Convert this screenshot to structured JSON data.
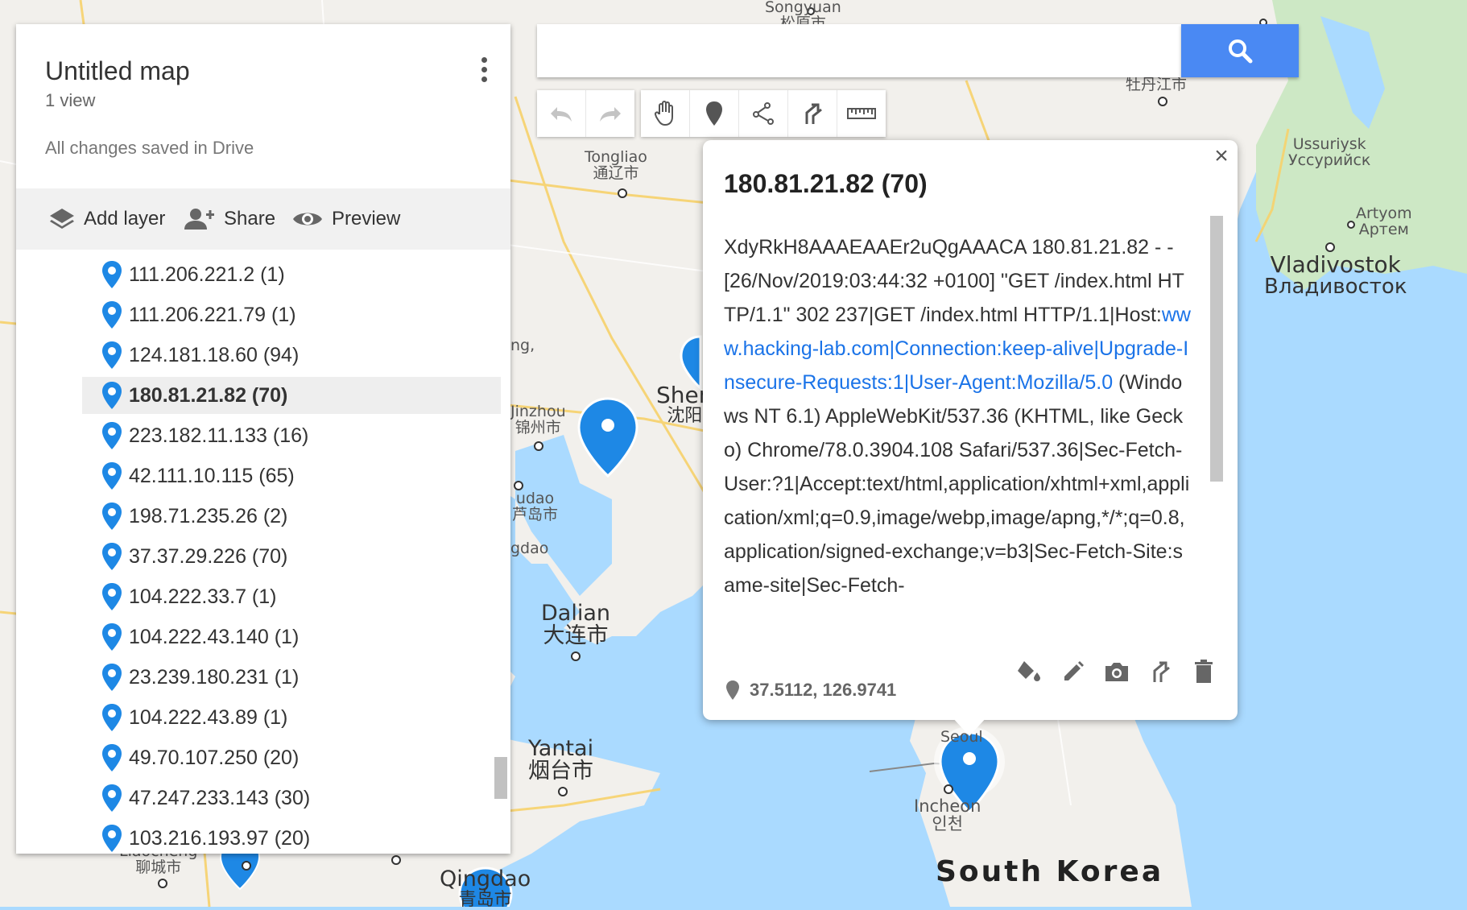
{
  "panel": {
    "title": "Untitled map",
    "views": "1 view",
    "save_status": "All changes saved in Drive",
    "toolbar": {
      "add_layer": "Add layer",
      "share": "Share",
      "preview": "Preview"
    },
    "items": [
      {
        "label": "111.206.221.2 (1)"
      },
      {
        "label": "111.206.221.79 (1)"
      },
      {
        "label": "124.181.18.60 (94)"
      },
      {
        "label": "180.81.21.82 (70)",
        "selected": true
      },
      {
        "label": "223.182.11.133 (16)"
      },
      {
        "label": "42.111.10.115 (65)"
      },
      {
        "label": "198.71.235.26 (2)"
      },
      {
        "label": "37.37.29.226 (70)"
      },
      {
        "label": "104.222.33.7 (1)"
      },
      {
        "label": "104.222.43.140 (1)"
      },
      {
        "label": "23.239.180.231 (1)"
      },
      {
        "label": "104.222.43.89 (1)"
      },
      {
        "label": "49.70.107.250 (20)"
      },
      {
        "label": "47.247.233.143 (30)"
      },
      {
        "label": "103.216.193.97 (20)"
      }
    ]
  },
  "search": {
    "placeholder": ""
  },
  "toolbar_icons": [
    "undo-icon",
    "redo-icon",
    "hand-icon",
    "marker-icon",
    "draw-line-icon",
    "directions-icon",
    "ruler-icon"
  ],
  "info": {
    "title": "180.81.21.82 (70)",
    "body_plain_1": "XdyRkH8AAAEAAEr2uQgAAACA 180.81.21.82 - - [26/Nov/2019:03:44:32 +0100] \"GET /index.html HTTP/1.1\" 302 237|GET /index.html HTTP/1.1|Host:",
    "body_link": "www.hacking-lab.com|Connection:keep-alive|Upgrade-Insecure-Requests:1|User-Agent:Mozilla/5.0",
    "body_plain_2": " (Windows NT 6.1) AppleWebKit/537.36 (KHTML, like Gecko) Chrome/78.0.3904.108 Safari/537.36|Sec-Fetch-User:?1|Accept:text/html,application/xhtml+xml,application/xml;q=0.9,image/webp,image/apng,*/*;q=0.8,application/signed-exchange;v=b3|Sec-Fetch-Site:same-site|Sec-Fetch-",
    "coords": "37.5112, 126.9741"
  },
  "map_labels": {
    "songyuan": "Songyuan",
    "songyuan_cn": "松原市",
    "mudanjiang_cn": "牡丹江市",
    "tongliao": "Tongliao",
    "tongliao_cn": "通辽市",
    "ussuriysk": "Ussuriysk",
    "ussuriysk_ru": "Уссурийск",
    "artyom": "Artyom",
    "artyom_ru": "Артем",
    "vladivostok": "Vladivostok",
    "vladivostok_ru": "Владивосток",
    "shen": "Shen",
    "shen_cn": "沈阳",
    "jinzhou": "Jinzhou",
    "jinzhou_cn": "锦州市",
    "udao": "udao",
    "udao_cn": "芦岛市",
    "gdao": "gdao",
    "ng": "ng,",
    "dalian": "Dalian",
    "dalian_cn": "大连市",
    "yantai": "Yantai",
    "yantai_cn": "烟台市",
    "seoul": "Seoul",
    "incheon": "Incheon",
    "incheon_kr": "인천",
    "south_korea": "South Korea",
    "liaocheng": "Liaocheng",
    "liaocheng_cn": "聊城市",
    "qingdao": "Qingdao",
    "qingdao_cn": "青岛市"
  },
  "colors": {
    "accent": "#4a89f3",
    "marker": "#1e88e5",
    "link": "#1a73e8"
  }
}
